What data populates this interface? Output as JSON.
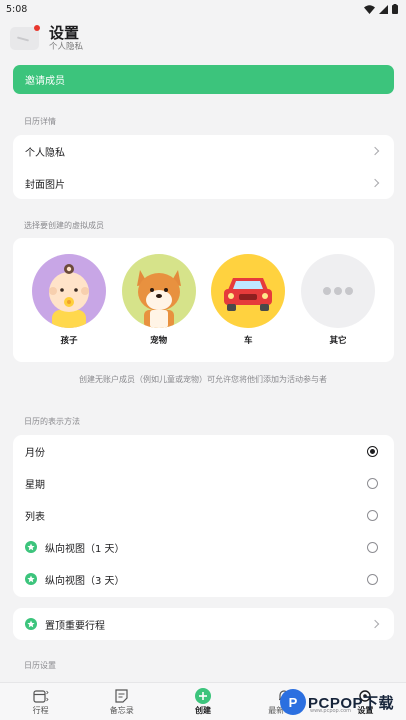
{
  "status_bar": {
    "time": "5:08"
  },
  "header": {
    "title": "设置",
    "subtitle": "个人隐私"
  },
  "invite_button": "邀请成员",
  "calendar_details": {
    "section_label": "日历详情",
    "items": [
      {
        "label": "个人隐私"
      },
      {
        "label": "封面图片"
      }
    ]
  },
  "virtual_members": {
    "section_label": "选择要创建的虚拟成员",
    "items": [
      {
        "label": "孩子",
        "icon": "child-avatar-icon",
        "color": "#c8a6e6"
      },
      {
        "label": "宠物",
        "icon": "dog-avatar-icon",
        "color": "#d6e38a"
      },
      {
        "label": "车",
        "icon": "car-avatar-icon",
        "color": "#ffd23f"
      },
      {
        "label": "其它",
        "icon": "more-dots-icon",
        "color": "#efeff1"
      }
    ],
    "hint": "创建无账户成员（例如儿童或宠物）可允许您将他们添加为活动参与者"
  },
  "display_method": {
    "section_label": "日历的表示方法",
    "options": [
      {
        "label": "月份",
        "selected": true,
        "starred": false
      },
      {
        "label": "星期",
        "selected": false,
        "starred": false
      },
      {
        "label": "列表",
        "selected": false,
        "starred": false
      },
      {
        "label": "纵向视图（1 天）",
        "selected": false,
        "starred": true
      },
      {
        "label": "纵向视图（3 天）",
        "selected": false,
        "starred": true
      }
    ]
  },
  "pin_item": {
    "label": "置顶重要行程"
  },
  "calendar_settings": {
    "section_label": "日历设置"
  },
  "bottom_nav": {
    "items": [
      {
        "label": "行程",
        "icon": "calendar-icon"
      },
      {
        "label": "备忘录",
        "icon": "memo-icon"
      },
      {
        "label": "创建",
        "icon": "add-circle-icon",
        "active": true
      },
      {
        "label": "最新动态",
        "icon": "bell-icon"
      },
      {
        "label": "设置",
        "icon": "settings-icon"
      }
    ]
  },
  "watermark": {
    "text": "PCPOP下载",
    "sub": "www.pcpop.com"
  },
  "colors": {
    "accent": "#3cc47c",
    "background": "#f3f3f4",
    "card": "#ffffff"
  }
}
